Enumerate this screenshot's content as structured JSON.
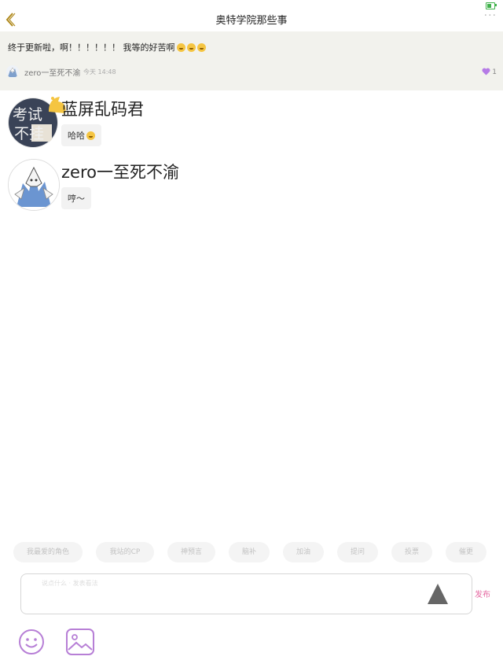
{
  "nav": {
    "title": "奥特学院那些事",
    "more_label": "···"
  },
  "post": {
    "text": "终于更新啦，啊！！！！！！ 我等的好苦啊",
    "emoji_count": 3,
    "author": "zero一至死不渝",
    "time": "今天 14:48",
    "likes": "1",
    "colors": {
      "background": "#f2f2ed",
      "like": "#b57be6"
    }
  },
  "comments": [
    {
      "name": "蓝屏乱码君",
      "text": "哈哈",
      "avatar_text": [
        "考试",
        "不挂"
      ]
    },
    {
      "name": "zero一至死不渝",
      "text": "哼～"
    }
  ],
  "tags": [
    "我最爱的角色",
    "我站的CP",
    "神预言",
    "脑补",
    "加油",
    "提问",
    "投票",
    "催更"
  ],
  "input": {
    "placeholder": "说点什么 · 发表看法",
    "publish_label": "发布"
  },
  "icons": [
    "back-chevron-icon",
    "more-dots-icon",
    "heart-icon",
    "emoji-icon",
    "image-icon"
  ],
  "accent": {
    "back": "#b08a1e",
    "publish": "#e66aa3",
    "tool": "#b77fd6"
  }
}
